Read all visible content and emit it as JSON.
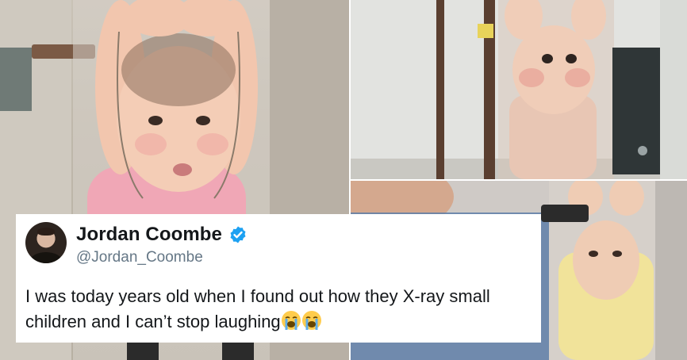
{
  "tweet": {
    "display_name": "Jordan Coombe",
    "handle": "@Jordan_Coombe",
    "text_line1": "I was today years old when I found out how they X-ray small",
    "text_line2": "children and I can’t stop laughing",
    "emojis": [
      "loudly-crying-face-emoji",
      "loudly-crying-face-emoji"
    ]
  },
  "icons": {
    "verified": "verified-badge-icon"
  },
  "colors": {
    "verified_blue": "#1da1f2",
    "text": "#14171a",
    "handle": "#657786",
    "card": "#ffffff"
  }
}
